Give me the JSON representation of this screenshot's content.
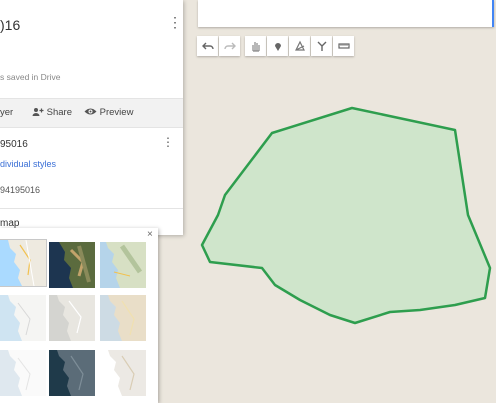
{
  "map": {
    "polygon_fill": "#cfe5cb",
    "polygon_stroke": "#2e9e4e",
    "background": "#ebe6dd"
  },
  "search": {
    "placeholder": ""
  },
  "toolbar": {
    "tools": [
      "undo-icon",
      "redo-icon",
      "hand-icon",
      "marker-icon",
      "polygon-icon",
      "route-icon",
      "ruler-icon"
    ]
  },
  "panel": {
    "title": ")16",
    "more_glyph": "⋮",
    "saved_text": "s saved in Drive",
    "actions": {
      "layer_label": "yer",
      "share_label": "Share",
      "preview_label": "Preview"
    },
    "layer": {
      "name": "95016",
      "more_glyph": "⋮",
      "styles_link": "dividual styles",
      "item_label": "94195016"
    },
    "basemap_label": "map"
  },
  "basemap_picker": {
    "close_glyph": "×",
    "thumbnails": [
      {
        "style": "map",
        "selected": true
      },
      {
        "style": "satellite"
      },
      {
        "style": "terrain"
      },
      {
        "style": "light-political"
      },
      {
        "style": "mono-city"
      },
      {
        "style": "simple-atlas"
      },
      {
        "style": "light-landmass"
      },
      {
        "style": "dark-landmass"
      },
      {
        "style": "whitewater"
      }
    ]
  }
}
